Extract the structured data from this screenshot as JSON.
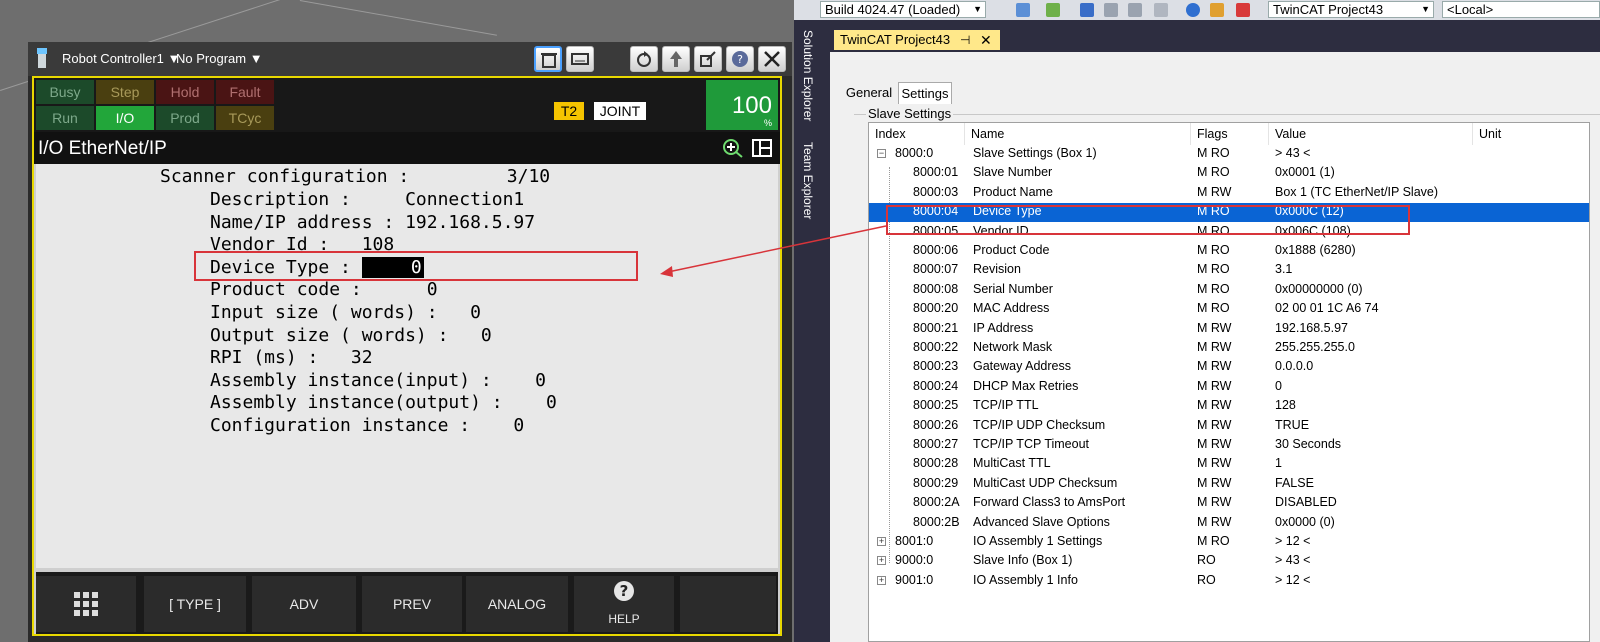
{
  "pendant": {
    "controller": "Robot Controller1",
    "program": "No Program",
    "status_row1": [
      "Busy",
      "Step",
      "Hold",
      "Fault"
    ],
    "status_row2": [
      "Run",
      "I/O",
      "Prod",
      "TCyc"
    ],
    "mode": "T2",
    "coord": "JOINT",
    "override": "100",
    "override_unit": "%",
    "screen_title": "I/O EtherNet/IP",
    "lines": {
      "l1": "Scanner configuration :         3/10",
      "l2": "Description :     Connection1",
      "l3": "Name/IP address : 192.168.5.97",
      "l4": "Vendor Id :   108",
      "l5_label": "Device Type : ",
      "l5_value": "0",
      "l6": "Product code :      0",
      "l7": "Input size ( words) :   0",
      "l8": "Output size ( words) :   0",
      "l9": "RPI (ms) :   32",
      "l10": "Assembly instance(input) :    0",
      "l11": "Assembly instance(output) :    0",
      "l12": "Configuration instance :    0"
    },
    "fkeys": [
      "[ TYPE ]",
      "ADV",
      "PREV",
      "ANALOG",
      "HELP"
    ]
  },
  "twincat": {
    "build": "Build 4024.47 (Loaded)",
    "project": "TwinCAT Project43",
    "target": "<Local>",
    "side_tabs": [
      "Solution Explorer",
      "Team Explorer"
    ],
    "doc_tab": "TwinCAT Project43",
    "pin": "⊣",
    "subtabs": [
      "General",
      "Settings"
    ],
    "group": "Slave Settings",
    "columns": [
      "Index",
      "Name",
      "Flags",
      "Value",
      "Unit"
    ],
    "rows": [
      {
        "exp": "−",
        "index": "8000:0",
        "name": "Slave Settings (Box 1)",
        "flags": "M RO",
        "value": "> 43 <"
      },
      {
        "index": "8000:01",
        "name": "Slave Number",
        "flags": "M RO",
        "value": "0x0001 (1)"
      },
      {
        "index": "8000:03",
        "name": "Product Name",
        "flags": "M RW",
        "value": "Box 1 (TC EtherNet/IP Slave)"
      },
      {
        "index": "8000:04",
        "name": "Device Type",
        "flags": "M RO",
        "value": "0x000C (12)",
        "selected": true
      },
      {
        "index": "8000:05",
        "name": "Vendor ID",
        "flags": "M RO",
        "value": "0x006C (108)"
      },
      {
        "index": "8000:06",
        "name": "Product Code",
        "flags": "M RO",
        "value": "0x1888 (6280)"
      },
      {
        "index": "8000:07",
        "name": "Revision",
        "flags": "M RO",
        "value": "3.1"
      },
      {
        "index": "8000:08",
        "name": "Serial Number",
        "flags": "M RO",
        "value": "0x00000000 (0)"
      },
      {
        "index": "8000:20",
        "name": "MAC Address",
        "flags": "M RO",
        "value": "02 00 01 1C A6 74"
      },
      {
        "index": "8000:21",
        "name": "IP Address",
        "flags": "M RW",
        "value": "192.168.5.97"
      },
      {
        "index": "8000:22",
        "name": "Network Mask",
        "flags": "M RW",
        "value": "255.255.255.0"
      },
      {
        "index": "8000:23",
        "name": "Gateway Address",
        "flags": "M RW",
        "value": "0.0.0.0"
      },
      {
        "index": "8000:24",
        "name": "DHCP Max Retries",
        "flags": "M RW",
        "value": "0"
      },
      {
        "index": "8000:25",
        "name": "TCP/IP TTL",
        "flags": "M RW",
        "value": "128"
      },
      {
        "index": "8000:26",
        "name": "TCP/IP UDP Checksum",
        "flags": "M RW",
        "value": "TRUE"
      },
      {
        "index": "8000:27",
        "name": "TCP/IP TCP Timeout",
        "flags": "M RW",
        "value": "30 Seconds"
      },
      {
        "index": "8000:28",
        "name": "MultiCast TTL",
        "flags": "M RW",
        "value": "1"
      },
      {
        "index": "8000:29",
        "name": "MultiCast UDP Checksum",
        "flags": "M RW",
        "value": "FALSE"
      },
      {
        "index": "8000:2A",
        "name": "Forward Class3 to AmsPort",
        "flags": "M RW",
        "value": "DISABLED"
      },
      {
        "index": "8000:2B",
        "name": "Advanced Slave Options",
        "flags": "M RW",
        "value": "0x0000 (0)"
      },
      {
        "exp": "+",
        "index": "8001:0",
        "name": "IO Assembly 1 Settings",
        "flags": "M RO",
        "value": "> 12 <"
      },
      {
        "exp": "+",
        "index": "9000:0",
        "name": "Slave Info (Box 1)",
        "flags": "RO",
        "value": "> 43 <"
      },
      {
        "exp": "+",
        "index": "9001:0",
        "name": "IO Assembly 1 Info",
        "flags": "RO",
        "value": "> 12 <"
      }
    ]
  }
}
